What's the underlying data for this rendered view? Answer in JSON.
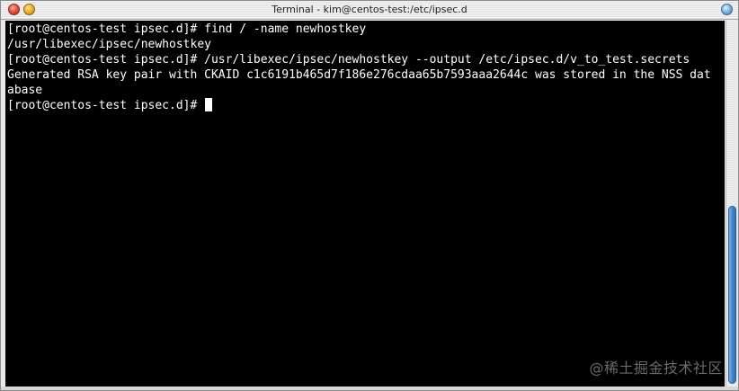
{
  "window": {
    "title": "Terminal - kim@centos-test:/etc/ipsec.d"
  },
  "terminal": {
    "lines": [
      "[root@centos-test ipsec.d]# find / -name newhostkey",
      "/usr/libexec/ipsec/newhostkey",
      "[root@centos-test ipsec.d]# /usr/libexec/ipsec/newhostkey --output /etc/ipsec.d/v_to_test.secrets",
      "Generated RSA key pair with CKAID c1c6191b465d7f186e276cdaa65b7593aaa2644c was stored in the NSS dat",
      "abase",
      "[root@centos-test ipsec.d]# "
    ]
  },
  "watermark": "@稀土掘金技术社区",
  "icons": {
    "close": "close-icon",
    "minimize": "minimize-icon",
    "zoom": "zoom-icon"
  },
  "colors": {
    "terminal_bg": "#000000",
    "terminal_fg": "#ffffff",
    "close": "#e8503d",
    "minimize": "#f2b12d",
    "scroll_thumb": "#4b8ad1"
  }
}
